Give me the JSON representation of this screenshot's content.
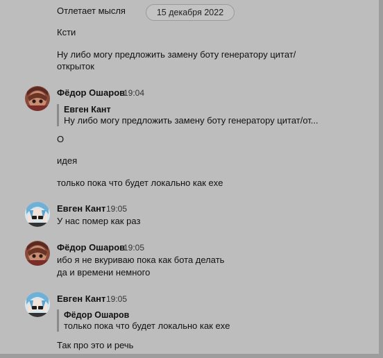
{
  "date_pill": "15 декабря 2022",
  "top_messages": [
    "Отлетает мысля",
    "Ксти",
    "Ну либо могу предложить замену боту генератору цитат/",
    "открыток"
  ],
  "groups": [
    {
      "author": "Фёдор Ошаров",
      "time": "19:04",
      "quote": {
        "author": "Евген Кант",
        "text": "Ну либо могу предложить замену боту генератору цитат/от..."
      },
      "messages": [
        "О",
        "идея",
        "только пока что будет локально как exe"
      ]
    },
    {
      "author": "Евген Кант",
      "time": "19:05",
      "messages": [
        "У нас помер как раз"
      ]
    },
    {
      "author": "Фёдор Ошаров",
      "time": "19:05",
      "messages": [
        "ибо я не вкуриваю пока как бота делать",
        "да и времени немного"
      ]
    },
    {
      "author": "Евген Кант",
      "time": "19:05",
      "quote": {
        "author": "Фёдор Ошаров",
        "text": "только пока что будет локально как exe"
      },
      "messages": [
        "Так про это и речь"
      ]
    }
  ]
}
